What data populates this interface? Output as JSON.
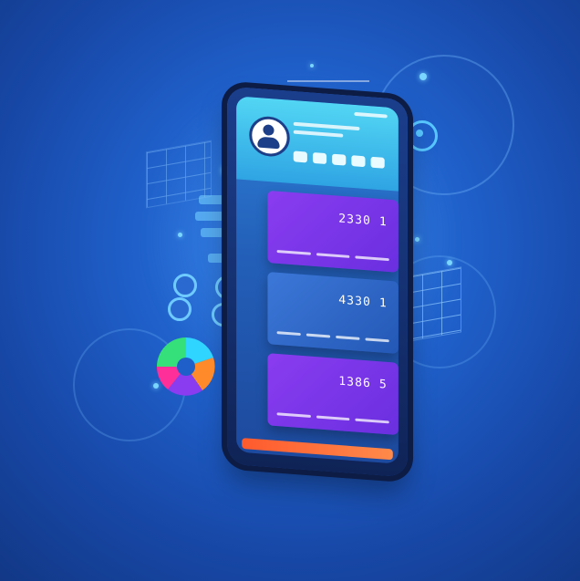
{
  "scene": {
    "card_numbers": [
      "2330 1",
      "4330 1",
      "1386 5"
    ],
    "rating_stars": 5,
    "icons": [
      "person-icon",
      "gear-icon",
      "pie-chart-icon",
      "grid-panel-icon",
      "star-icon"
    ],
    "colors": {
      "background": "#1f5fc9",
      "card_purple": "#7b35ea",
      "card_blue": "#2f6bc8",
      "accent_cyan": "#52d6f4",
      "accent_orange": "#ff6a36",
      "star": "#ffd23a"
    }
  }
}
